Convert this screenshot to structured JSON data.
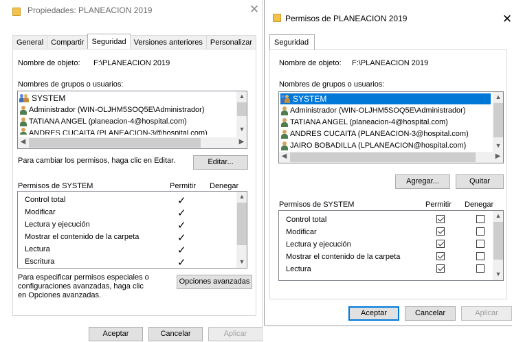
{
  "left_window": {
    "title": "Propiedades: PLANEACION 2019",
    "tabs": [
      "General",
      "Compartir",
      "Seguridad",
      "Versiones anteriores",
      "Personalizar"
    ],
    "object_name_label": "Nombre de objeto:",
    "object_name_value": "F:\\PLANEACION 2019",
    "groups_label": "Nombres de grupos o usuarios:",
    "users": [
      {
        "name": "SYSTEM",
        "icon": "group-icon"
      },
      {
        "name": "Administrador (WIN-OLJHM5SOQ5E\\Administrador)",
        "icon": "user-icon"
      },
      {
        "name": "TATIANA ANGEL (planeacion-4@hospital.com)",
        "icon": "user-icon"
      },
      {
        "name": "ANDRES CUCAITA (PLANEACION-3@hospital.com)",
        "icon": "user-icon"
      }
    ],
    "change_perms_text": "Para cambiar los permisos, haga clic en Editar.",
    "edit_button": "Editar...",
    "perms_header": "Permisos de SYSTEM",
    "allow_header": "Permitir",
    "deny_header": "Denegar",
    "permissions": [
      {
        "name": "Control total",
        "allow": true
      },
      {
        "name": "Modificar",
        "allow": true
      },
      {
        "name": "Lectura y ejecución",
        "allow": true
      },
      {
        "name": "Mostrar el contenido de la carpeta",
        "allow": true
      },
      {
        "name": "Lectura",
        "allow": true
      },
      {
        "name": "Escritura",
        "allow": true
      }
    ],
    "advanced_text": [
      "Para especificar permisos especiales o",
      "configuraciones avanzadas, haga clic",
      "en Opciones avanzadas."
    ],
    "advanced_button": "Opciones avanzadas",
    "ok_button": "Aceptar",
    "cancel_button": "Cancelar",
    "apply_button": "Aplicar"
  },
  "right_window": {
    "title": "Permisos de PLANEACION 2019",
    "tab": "Seguridad",
    "object_name_label": "Nombre de objeto:",
    "object_name_value": "F:\\PLANEACION 2019",
    "groups_label": "Nombres de grupos o usuarios:",
    "users": [
      {
        "name": "SYSTEM",
        "icon": "group-icon",
        "selected": true
      },
      {
        "name": "Administrador (WIN-OLJHM5SOQ5E\\Administrador)",
        "icon": "user-icon"
      },
      {
        "name": "TATIANA ANGEL (planeacion-4@hospital.com)",
        "icon": "user-icon"
      },
      {
        "name": "ANDRES CUCAITA (PLANEACION-3@hospital.com)",
        "icon": "user-icon"
      },
      {
        "name": "JAIRO BOBADILLA (LPLANEACION@hospital.com)",
        "icon": "user-icon"
      }
    ],
    "add_button": "Agregar...",
    "remove_button": "Quitar",
    "perms_header": "Permisos de SYSTEM",
    "allow_header": "Permitir",
    "deny_header": "Denegar",
    "permissions": [
      {
        "name": "Control total",
        "allow": true,
        "deny": false
      },
      {
        "name": "Modificar",
        "allow": true,
        "deny": false
      },
      {
        "name": "Lectura y ejecución",
        "allow": true,
        "deny": false
      },
      {
        "name": "Mostrar el contenido de la carpeta",
        "allow": true,
        "deny": false
      },
      {
        "name": "Lectura",
        "allow": true,
        "deny": false
      }
    ],
    "ok_button": "Aceptar",
    "cancel_button": "Cancelar",
    "apply_button": "Aplicar"
  },
  "colors": {
    "selection": "#0078d7",
    "folder": "#f2c24b"
  }
}
